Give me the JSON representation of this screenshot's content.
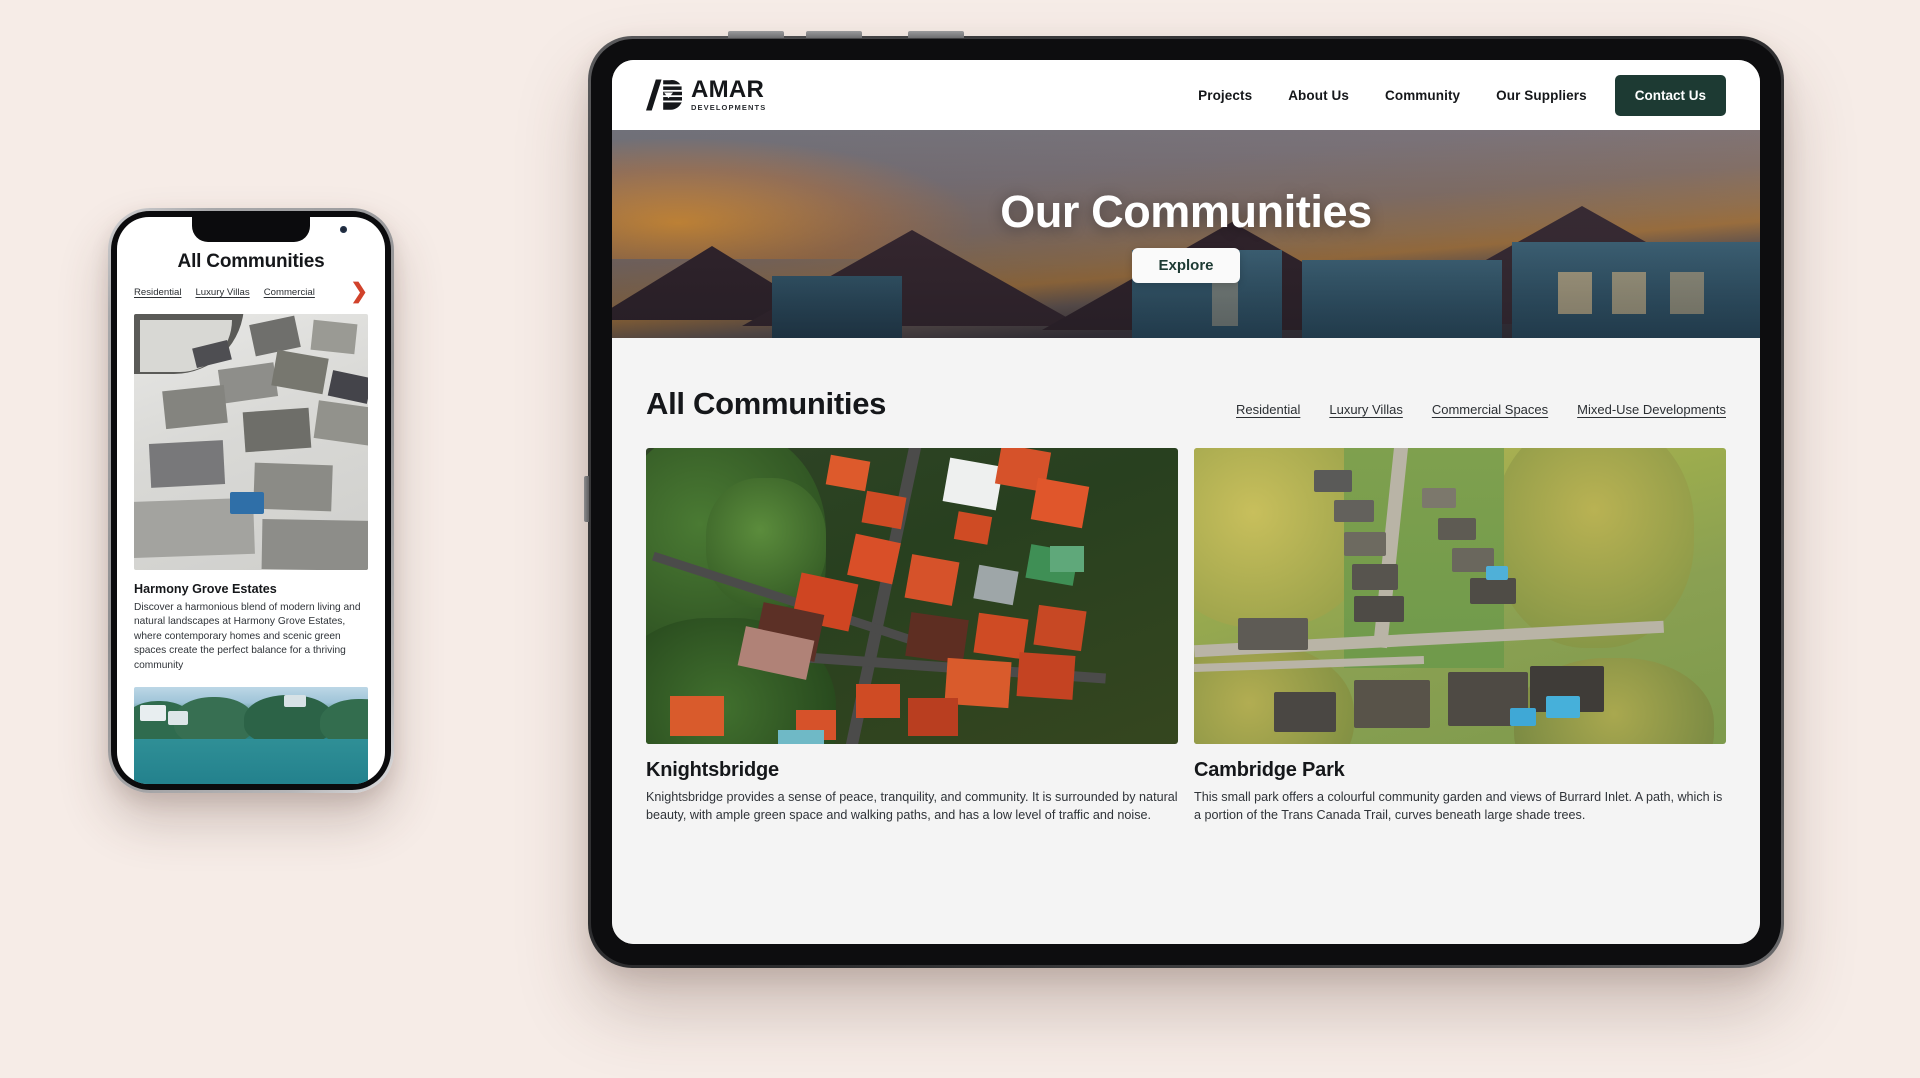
{
  "theme": {
    "page_bg": "#f6ece7",
    "accent_dark_green": "#1d3a33",
    "phone_arrow_red": "#d1422b",
    "section_bg": "#f4f4f4"
  },
  "tablet": {
    "header": {
      "logo": {
        "name": "AMAR",
        "tagline": "DEVELOPMENTS",
        "icon": "amar-logo-icon"
      },
      "nav": [
        {
          "label": "Projects"
        },
        {
          "label": "About Us"
        },
        {
          "label": "Community"
        },
        {
          "label": "Our Suppliers"
        }
      ],
      "cta": {
        "label": "Contact Us"
      }
    },
    "hero": {
      "title": "Our Communities",
      "button": "Explore"
    },
    "communities": {
      "title": "All Communities",
      "filters": [
        {
          "label": "Residential"
        },
        {
          "label": "Luxury Villas"
        },
        {
          "label": "Commercial Spaces"
        },
        {
          "label": "Mixed-Use Developments"
        }
      ],
      "cards": [
        {
          "name": "Knightsbridge",
          "description": "Knightsbridge provides a sense of peace, tranquility, and community. It is surrounded by natural beauty, with ample green space and walking paths, and has a low level of traffic and noise.",
          "image": "aerial-tropical-neighbourhood-photo"
        },
        {
          "name": "Cambridge Park",
          "description": "This small park offers a colourful community garden and views of Burrard Inlet. A path, which is a portion of the Trans Canada Trail, curves beneath large shade trees.",
          "image": "aerial-autumn-suburb-photo"
        }
      ]
    }
  },
  "phone": {
    "title": "All Communities",
    "filters": [
      {
        "label": "Residential"
      },
      {
        "label": "Luxury Villas"
      },
      {
        "label": "Commercial"
      }
    ],
    "next_arrow": "chevron-right-icon",
    "card": {
      "name": "Harmony Grove Estates",
      "description": "Discover a harmonious blend of modern living and natural landscapes at Harmony Grove Estates, where contemporary homes and scenic green spaces create the perfect balance for a thriving community",
      "image": "aerial-snow-covered-homes-photo"
    },
    "secondary_image": "lakeside-community-photo"
  }
}
